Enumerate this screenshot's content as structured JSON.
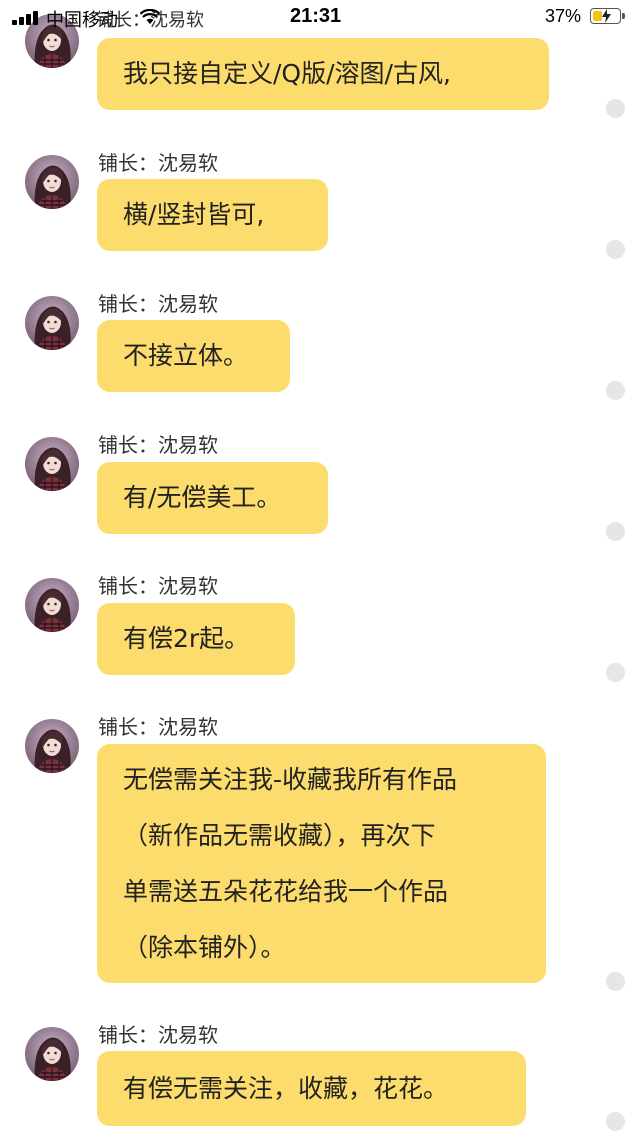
{
  "status_bar": {
    "carrier": "中国移动",
    "overlay_text": "铺长：沈易软",
    "time": "21:31",
    "battery": "37%",
    "battery_level": 0.37
  },
  "messages": [
    {
      "sender": "",
      "lines": [
        "我只接自定义/Q版/溶图/古风,"
      ]
    },
    {
      "sender": "铺长：沈易软",
      "lines": [
        "横/竖封皆可,"
      ]
    },
    {
      "sender": "铺长：沈易软",
      "lines": [
        "不接立体。"
      ]
    },
    {
      "sender": "铺长：沈易软",
      "lines": [
        "有/无偿美工。"
      ]
    },
    {
      "sender": "铺长：沈易软",
      "lines": [
        "有偿2r起。"
      ]
    },
    {
      "sender": "铺长：沈易软",
      "lines": [
        "无偿需关注我-收藏我所有作品",
        "（新作品无需收藏），再次下",
        "单需送五朵花花给我一个作品",
        "（除本铺外）。"
      ]
    },
    {
      "sender": "铺长：沈易软",
      "lines": [
        "有偿无需关注，收藏，花花。"
      ]
    }
  ],
  "colors": {
    "bubble": "#fcdc6d",
    "status_dot": "#e6e6e6"
  },
  "icons": {
    "avatar": "avatar-girl-portrait",
    "status_dot": "message-status-dot"
  }
}
